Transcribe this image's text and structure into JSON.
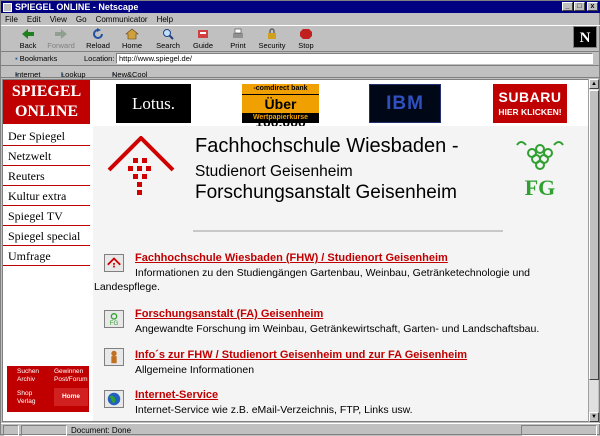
{
  "window": {
    "title": "SPIEGEL ONLINE - Netscape"
  },
  "menu": [
    "File",
    "Edit",
    "View",
    "Go",
    "Communicator",
    "Help"
  ],
  "toolbar": {
    "back": "Back",
    "forward": "Forward",
    "reload": "Reload",
    "home": "Home",
    "search": "Search",
    "guide": "Guide",
    "print": "Print",
    "security": "Security",
    "stop": "Stop"
  },
  "location": {
    "bookmarks": "Bookmarks",
    "label": "Location:",
    "url": "http://www.spiegel.de/"
  },
  "personal": {
    "internet": "Internet",
    "lookup": "Lookup",
    "newcool": "New&Cool"
  },
  "spiegel": {
    "logo_line1": "SPIEGEL",
    "logo_line2": "ONLINE",
    "nav": [
      "Der Spiegel",
      "Netzwelt",
      "Reuters",
      "Kultur extra",
      "Spiegel TV",
      "Spiegel special",
      "Umfrage"
    ],
    "footer": {
      "suchen": "Suchen",
      "archiv": "Archiv",
      "gewinnen": "Gewinnen",
      "post": "Post/Forum",
      "shop": "Shop",
      "verlag": "Verlag",
      "home": "Home"
    }
  },
  "banners": {
    "lotus": "Lotus.",
    "comdirect_top": "-comdirect bank",
    "comdirect_main": "Über 100.000",
    "comdirect_bottom": "Wertpapierkurse",
    "ibm": "IBM",
    "subaru_main": "SUBARU",
    "subaru_sub": "HIER KLICKEN!"
  },
  "header": {
    "line1": "Fachhochschule Wiesbaden -",
    "line2": "Studienort Geisenheim",
    "line3": "Forschungsanstalt Geisenheim",
    "fig_logo": "FG"
  },
  "sections": [
    {
      "link": "Fachhochschule Wiesbaden (FHW) / Studienort Geisenheim",
      "desc": "Informationen zu den Studiengängen Gartenbau, Weinbau, Getränketechnologie und Landespflege."
    },
    {
      "link": "Forschungsanstalt (FA) Geisenheim",
      "desc": "Angewandte Forschung im Weinbau, Getränkewirtschaft, Garten- und Landschaftsbau."
    },
    {
      "link": "Info´s zur FHW / Studienort Geisenheim und zur FA Geisenheim",
      "desc": "Allgemeine Informationen"
    },
    {
      "link": "Internet-Service",
      "desc": "Internet-Service wie z.B. eMail-Verzeichnis, FTP, Links usw."
    }
  ],
  "status": {
    "text": "Document: Done"
  },
  "colors": {
    "spiegel_red": "#c00000",
    "link_red": "#c00000",
    "titlebar": "#000080"
  }
}
